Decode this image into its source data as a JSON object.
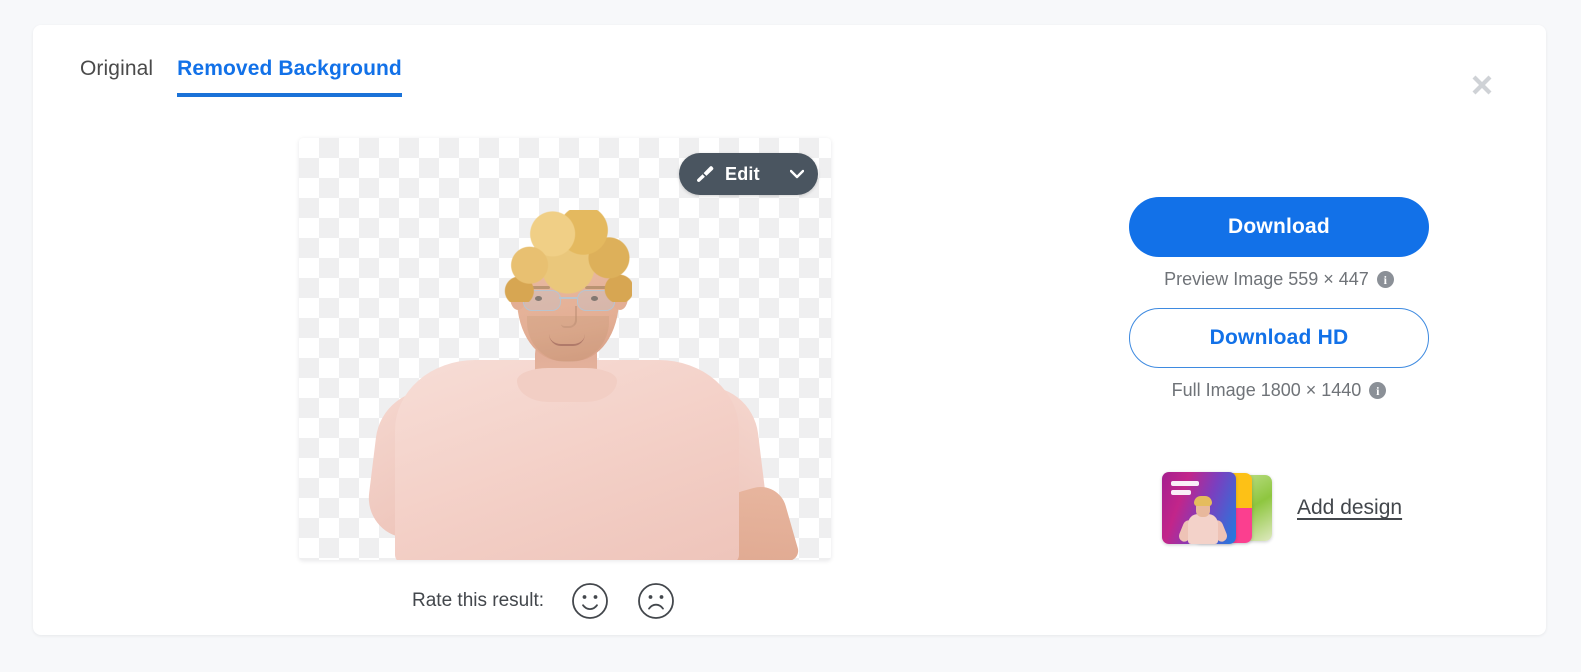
{
  "page": {
    "background_color": "#f7f8fa",
    "card_background": "#ffffff"
  },
  "tabs": [
    {
      "label": "Original",
      "active": false,
      "name": "tab-original"
    },
    {
      "label": "Removed Background",
      "active": true,
      "name": "tab-removed-background"
    }
  ],
  "close": {
    "icon": "close-icon",
    "color": "#cfd2d6"
  },
  "preview": {
    "canvas_label": "transparent-checkerboard-preview",
    "image_alt": "Man with curly blond hair and glasses wearing a light pink t-shirt",
    "edit": {
      "label": "Edit",
      "brush_icon": "paintbrush-icon",
      "caret_icon": "chevron-down-icon",
      "background_color": "#4a5560"
    }
  },
  "rating": {
    "label": "Rate this result:",
    "positive_icon": "smiley-face-icon",
    "negative_icon": "frowny-face-icon"
  },
  "actions": {
    "download": {
      "label": "Download",
      "color": "#1271e8",
      "meta": "Preview Image 559 × 447",
      "info_icon": "info-icon",
      "info_glyph": "i"
    },
    "download_hd": {
      "label": "Download HD",
      "color": "#1271e8",
      "meta": "Full Image 1800 × 1440",
      "info_icon": "info-icon",
      "info_glyph": "i"
    }
  },
  "add_design": {
    "label": "Add design",
    "thumbnail_name": "design-template-thumbnails"
  }
}
